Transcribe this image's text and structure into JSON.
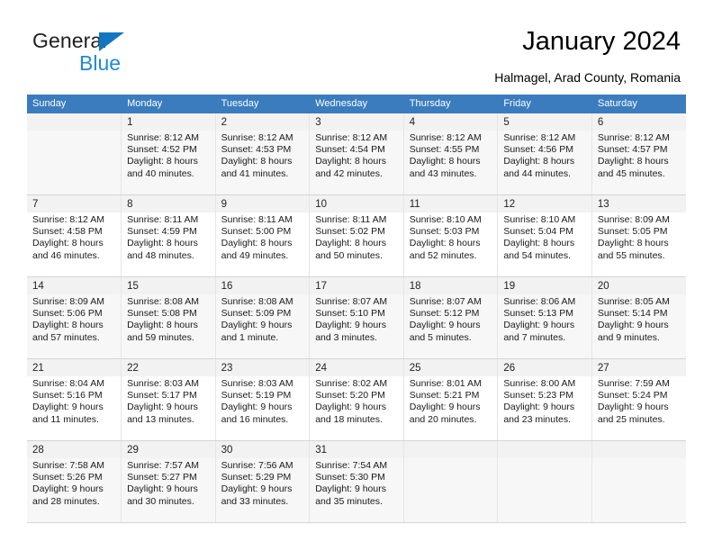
{
  "brand": {
    "name_part1": "General",
    "name_part2": "Blue",
    "triangle_color": "#1277c0",
    "blue_color": "#1f8ad6"
  },
  "header": {
    "title": "January 2024",
    "subtitle": "Halmagel, Arad County, Romania",
    "header_bg": "#3a7cbe"
  },
  "calendar": {
    "weekdays": [
      "Sunday",
      "Monday",
      "Tuesday",
      "Wednesday",
      "Thursday",
      "Friday",
      "Saturday"
    ],
    "weeks": [
      [
        {
          "day": "",
          "lines": []
        },
        {
          "day": "1",
          "lines": [
            "Sunrise: 8:12 AM",
            "Sunset: 4:52 PM",
            "Daylight: 8 hours",
            "and 40 minutes."
          ]
        },
        {
          "day": "2",
          "lines": [
            "Sunrise: 8:12 AM",
            "Sunset: 4:53 PM",
            "Daylight: 8 hours",
            "and 41 minutes."
          ]
        },
        {
          "day": "3",
          "lines": [
            "Sunrise: 8:12 AM",
            "Sunset: 4:54 PM",
            "Daylight: 8 hours",
            "and 42 minutes."
          ]
        },
        {
          "day": "4",
          "lines": [
            "Sunrise: 8:12 AM",
            "Sunset: 4:55 PM",
            "Daylight: 8 hours",
            "and 43 minutes."
          ]
        },
        {
          "day": "5",
          "lines": [
            "Sunrise: 8:12 AM",
            "Sunset: 4:56 PM",
            "Daylight: 8 hours",
            "and 44 minutes."
          ]
        },
        {
          "day": "6",
          "lines": [
            "Sunrise: 8:12 AM",
            "Sunset: 4:57 PM",
            "Daylight: 8 hours",
            "and 45 minutes."
          ]
        }
      ],
      [
        {
          "day": "7",
          "lines": [
            "Sunrise: 8:12 AM",
            "Sunset: 4:58 PM",
            "Daylight: 8 hours",
            "and 46 minutes."
          ]
        },
        {
          "day": "8",
          "lines": [
            "Sunrise: 8:11 AM",
            "Sunset: 4:59 PM",
            "Daylight: 8 hours",
            "and 48 minutes."
          ]
        },
        {
          "day": "9",
          "lines": [
            "Sunrise: 8:11 AM",
            "Sunset: 5:00 PM",
            "Daylight: 8 hours",
            "and 49 minutes."
          ]
        },
        {
          "day": "10",
          "lines": [
            "Sunrise: 8:11 AM",
            "Sunset: 5:02 PM",
            "Daylight: 8 hours",
            "and 50 minutes."
          ]
        },
        {
          "day": "11",
          "lines": [
            "Sunrise: 8:10 AM",
            "Sunset: 5:03 PM",
            "Daylight: 8 hours",
            "and 52 minutes."
          ]
        },
        {
          "day": "12",
          "lines": [
            "Sunrise: 8:10 AM",
            "Sunset: 5:04 PM",
            "Daylight: 8 hours",
            "and 54 minutes."
          ]
        },
        {
          "day": "13",
          "lines": [
            "Sunrise: 8:09 AM",
            "Sunset: 5:05 PM",
            "Daylight: 8 hours",
            "and 55 minutes."
          ]
        }
      ],
      [
        {
          "day": "14",
          "lines": [
            "Sunrise: 8:09 AM",
            "Sunset: 5:06 PM",
            "Daylight: 8 hours",
            "and 57 minutes."
          ]
        },
        {
          "day": "15",
          "lines": [
            "Sunrise: 8:08 AM",
            "Sunset: 5:08 PM",
            "Daylight: 8 hours",
            "and 59 minutes."
          ]
        },
        {
          "day": "16",
          "lines": [
            "Sunrise: 8:08 AM",
            "Sunset: 5:09 PM",
            "Daylight: 9 hours",
            "and 1 minute."
          ]
        },
        {
          "day": "17",
          "lines": [
            "Sunrise: 8:07 AM",
            "Sunset: 5:10 PM",
            "Daylight: 9 hours",
            "and 3 minutes."
          ]
        },
        {
          "day": "18",
          "lines": [
            "Sunrise: 8:07 AM",
            "Sunset: 5:12 PM",
            "Daylight: 9 hours",
            "and 5 minutes."
          ]
        },
        {
          "day": "19",
          "lines": [
            "Sunrise: 8:06 AM",
            "Sunset: 5:13 PM",
            "Daylight: 9 hours",
            "and 7 minutes."
          ]
        },
        {
          "day": "20",
          "lines": [
            "Sunrise: 8:05 AM",
            "Sunset: 5:14 PM",
            "Daylight: 9 hours",
            "and 9 minutes."
          ]
        }
      ],
      [
        {
          "day": "21",
          "lines": [
            "Sunrise: 8:04 AM",
            "Sunset: 5:16 PM",
            "Daylight: 9 hours",
            "and 11 minutes."
          ]
        },
        {
          "day": "22",
          "lines": [
            "Sunrise: 8:03 AM",
            "Sunset: 5:17 PM",
            "Daylight: 9 hours",
            "and 13 minutes."
          ]
        },
        {
          "day": "23",
          "lines": [
            "Sunrise: 8:03 AM",
            "Sunset: 5:19 PM",
            "Daylight: 9 hours",
            "and 16 minutes."
          ]
        },
        {
          "day": "24",
          "lines": [
            "Sunrise: 8:02 AM",
            "Sunset: 5:20 PM",
            "Daylight: 9 hours",
            "and 18 minutes."
          ]
        },
        {
          "day": "25",
          "lines": [
            "Sunrise: 8:01 AM",
            "Sunset: 5:21 PM",
            "Daylight: 9 hours",
            "and 20 minutes."
          ]
        },
        {
          "day": "26",
          "lines": [
            "Sunrise: 8:00 AM",
            "Sunset: 5:23 PM",
            "Daylight: 9 hours",
            "and 23 minutes."
          ]
        },
        {
          "day": "27",
          "lines": [
            "Sunrise: 7:59 AM",
            "Sunset: 5:24 PM",
            "Daylight: 9 hours",
            "and 25 minutes."
          ]
        }
      ],
      [
        {
          "day": "28",
          "lines": [
            "Sunrise: 7:58 AM",
            "Sunset: 5:26 PM",
            "Daylight: 9 hours",
            "and 28 minutes."
          ]
        },
        {
          "day": "29",
          "lines": [
            "Sunrise: 7:57 AM",
            "Sunset: 5:27 PM",
            "Daylight: 9 hours",
            "and 30 minutes."
          ]
        },
        {
          "day": "30",
          "lines": [
            "Sunrise: 7:56 AM",
            "Sunset: 5:29 PM",
            "Daylight: 9 hours",
            "and 33 minutes."
          ]
        },
        {
          "day": "31",
          "lines": [
            "Sunrise: 7:54 AM",
            "Sunset: 5:30 PM",
            "Daylight: 9 hours",
            "and 35 minutes."
          ]
        },
        {
          "day": "",
          "lines": []
        },
        {
          "day": "",
          "lines": []
        },
        {
          "day": "",
          "lines": []
        }
      ]
    ]
  }
}
